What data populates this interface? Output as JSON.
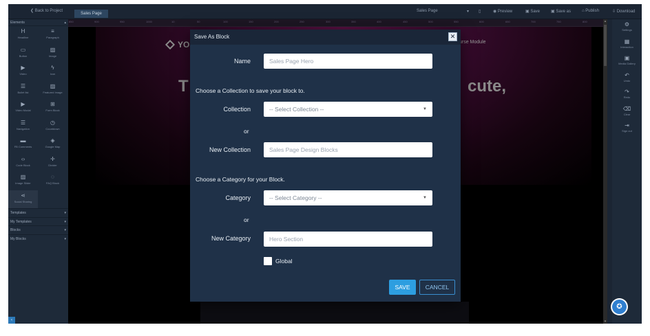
{
  "topbar": {
    "back_label": "❮ Back to Project",
    "page_tab": "Sales Page",
    "page_select": "Sales Page",
    "items": [
      {
        "icon": "▯",
        "label": ""
      },
      {
        "icon": "◉",
        "label": "Preview"
      },
      {
        "icon": "▣",
        "label": "Save"
      },
      {
        "icon": "▣",
        "label": "Save as"
      },
      {
        "icon": "⌂",
        "label": "Publish"
      },
      {
        "icon": "⇩",
        "label": "Download"
      }
    ]
  },
  "left_panel": {
    "header": "Elements",
    "elements": [
      {
        "icon": "H",
        "label": "Headline"
      },
      {
        "icon": "≡",
        "label": "Paragraph"
      },
      {
        "icon": "▭",
        "label": "Button"
      },
      {
        "icon": "▨",
        "label": "Image"
      },
      {
        "icon": "▶",
        "label": "Video"
      },
      {
        "icon": "ϟ",
        "label": "Icon"
      },
      {
        "icon": "☰",
        "label": "Bullet list"
      },
      {
        "icon": "▨",
        "label": "Featured Image"
      },
      {
        "icon": "▶",
        "label": "Video Modal"
      },
      {
        "icon": "⊞",
        "label": "Form Block"
      },
      {
        "icon": "☰",
        "label": "Navigation"
      },
      {
        "icon": "◷",
        "label": "Countdown"
      },
      {
        "icon": "▬",
        "label": "FB Comments"
      },
      {
        "icon": "◈",
        "label": "Google Map"
      },
      {
        "icon": "‹›",
        "label": "Code Block"
      },
      {
        "icon": "✛",
        "label": "Divider"
      },
      {
        "icon": "▨",
        "label": "Image Slider"
      },
      {
        "icon": "◌",
        "label": "FAQ Block"
      },
      {
        "icon": "⋖",
        "label": "Social Sharing"
      }
    ],
    "sections": [
      "Templates",
      "My Templates",
      "Blocks",
      "My Blocks"
    ],
    "collapse_icon": "‹"
  },
  "canvas": {
    "ruler_ticks": [
      "10",
      "50",
      "100",
      "150",
      "200",
      "250",
      "300",
      "350",
      "400",
      "450",
      "500",
      "550",
      "600",
      "650",
      "700",
      "750",
      "800",
      "850",
      "900",
      "950",
      "1000"
    ],
    "logo_text": "YO",
    "nav_text": "urse Module",
    "headline_left": "T",
    "headline_right": "cute,"
  },
  "right_panel": {
    "items": [
      {
        "icon": "⚙",
        "label": "Settings"
      },
      {
        "icon": "▦",
        "label": "Interaction"
      },
      {
        "icon": "▣",
        "label": "Media Gallery"
      },
      {
        "icon": "↶",
        "label": "Undo"
      },
      {
        "icon": "↷",
        "label": "Redo"
      },
      {
        "icon": "⌫",
        "label": "Clear"
      },
      {
        "icon": "⇥",
        "label": "Sign out"
      }
    ]
  },
  "modal": {
    "title": "Save As Block",
    "close_icon": "✕",
    "name_label": "Name",
    "name_placeholder": "Sales Page Hero",
    "collection_note": "Choose a Collection to save your block to.",
    "collection_label": "Collection",
    "collection_select": "-- Select Collection --",
    "or1": "or",
    "new_collection_label": "New Collection",
    "new_collection_placeholder": "Sales Page Design Blocks",
    "category_note": "Choose a Category for your Block.",
    "category_label": "Category",
    "category_select": "-- Select Category --",
    "or2": "or",
    "new_category_label": "New Category",
    "new_category_placeholder": "Hero Section",
    "global_label": "Global",
    "save_button": "SAVE",
    "cancel_button": "CANCEL"
  },
  "chat_icon": "✪"
}
